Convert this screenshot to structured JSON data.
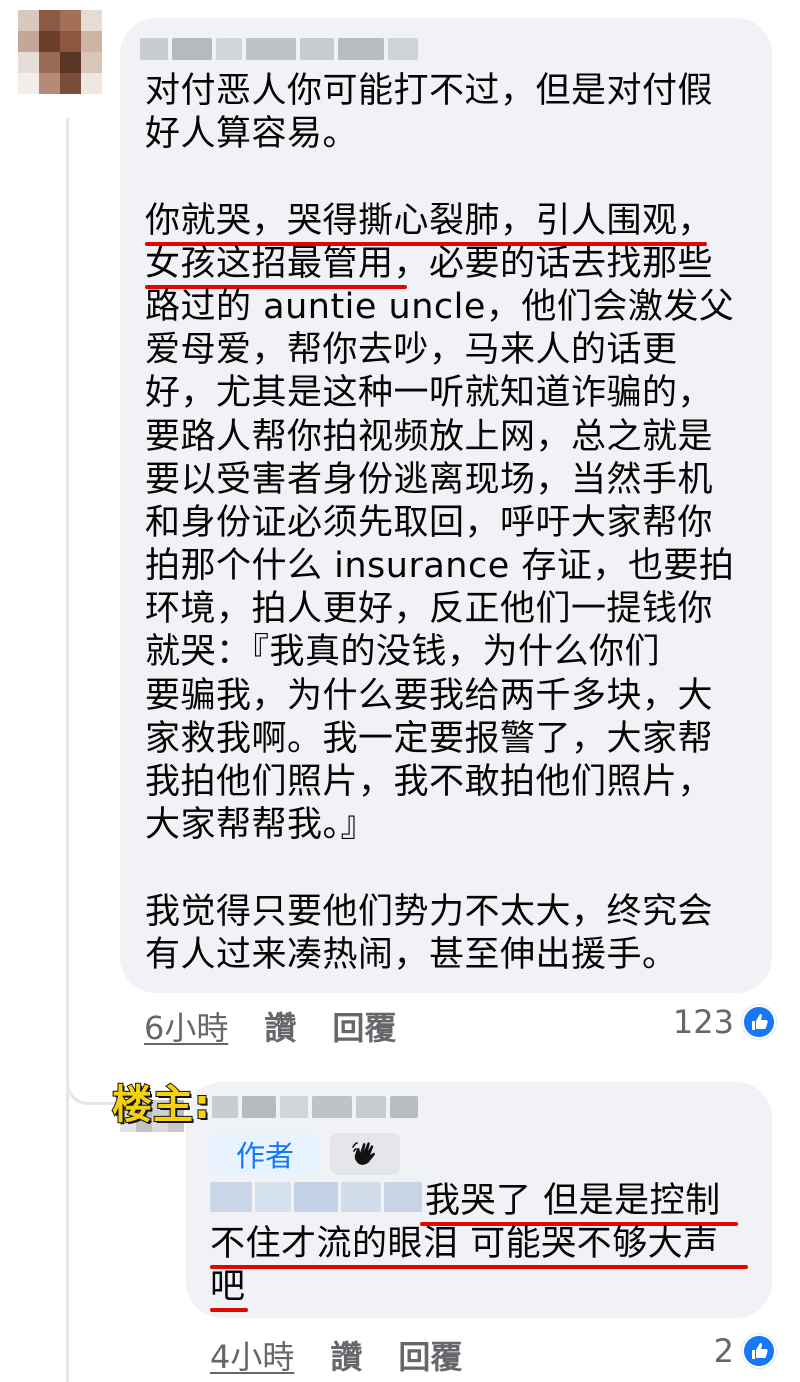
{
  "comment": {
    "lines": [
      "对付恶人你可能打不过，但是对付假",
      "好人算容易。",
      "",
      "你就哭，哭得撕心裂肺，引人围观，",
      "女孩这招最管用，必要的话去找那些",
      "路过的 auntie uncle，他们会激发父",
      "爱母爱，帮你去吵，马来人的话更",
      "好，尤其是这种一听就知道诈骗的，",
      "要路人帮你拍视频放上网，总之就是",
      "要以受害者身份逃离现场，当然手机",
      "和身份证必须先取回，呼吁大家帮你",
      "拍那个什么 insurance 存证，也要拍",
      "环境，拍人更好，反正他们一提钱你",
      "就哭：『我真的没钱，为什么你们",
      "要骗我，为什么要我给两千多块，大",
      "家救我啊。我一定要报警了，大家帮",
      "我拍他们照片，我不敢拍他们照片，",
      "大家帮帮我。』",
      "",
      "我觉得只要他们势力不太大，终究会",
      "有人过来凑热闹，甚至伸出援手。"
    ],
    "time": "6小時",
    "like_label": "讚",
    "reply_label": "回覆",
    "reaction_count": "123"
  },
  "reply": {
    "op_label": "楼主:",
    "author_badge": "作者",
    "lines": [
      "我哭了 但是是控制",
      "不住才流的眼泪 可能哭不够大声",
      "吧"
    ],
    "time": "4小時",
    "like_label": "讚",
    "reply_label": "回覆",
    "reaction_count": "2"
  },
  "colors": {
    "bubble": "#f0f2f5",
    "meta_text": "#65676b",
    "like_blue": "#1877f2",
    "underline_red": "#e10600",
    "op_label_yellow": "#f5d20d"
  },
  "icons": {
    "like": "thumbs-up-icon",
    "fan_badge": "hand-wave-icon"
  }
}
